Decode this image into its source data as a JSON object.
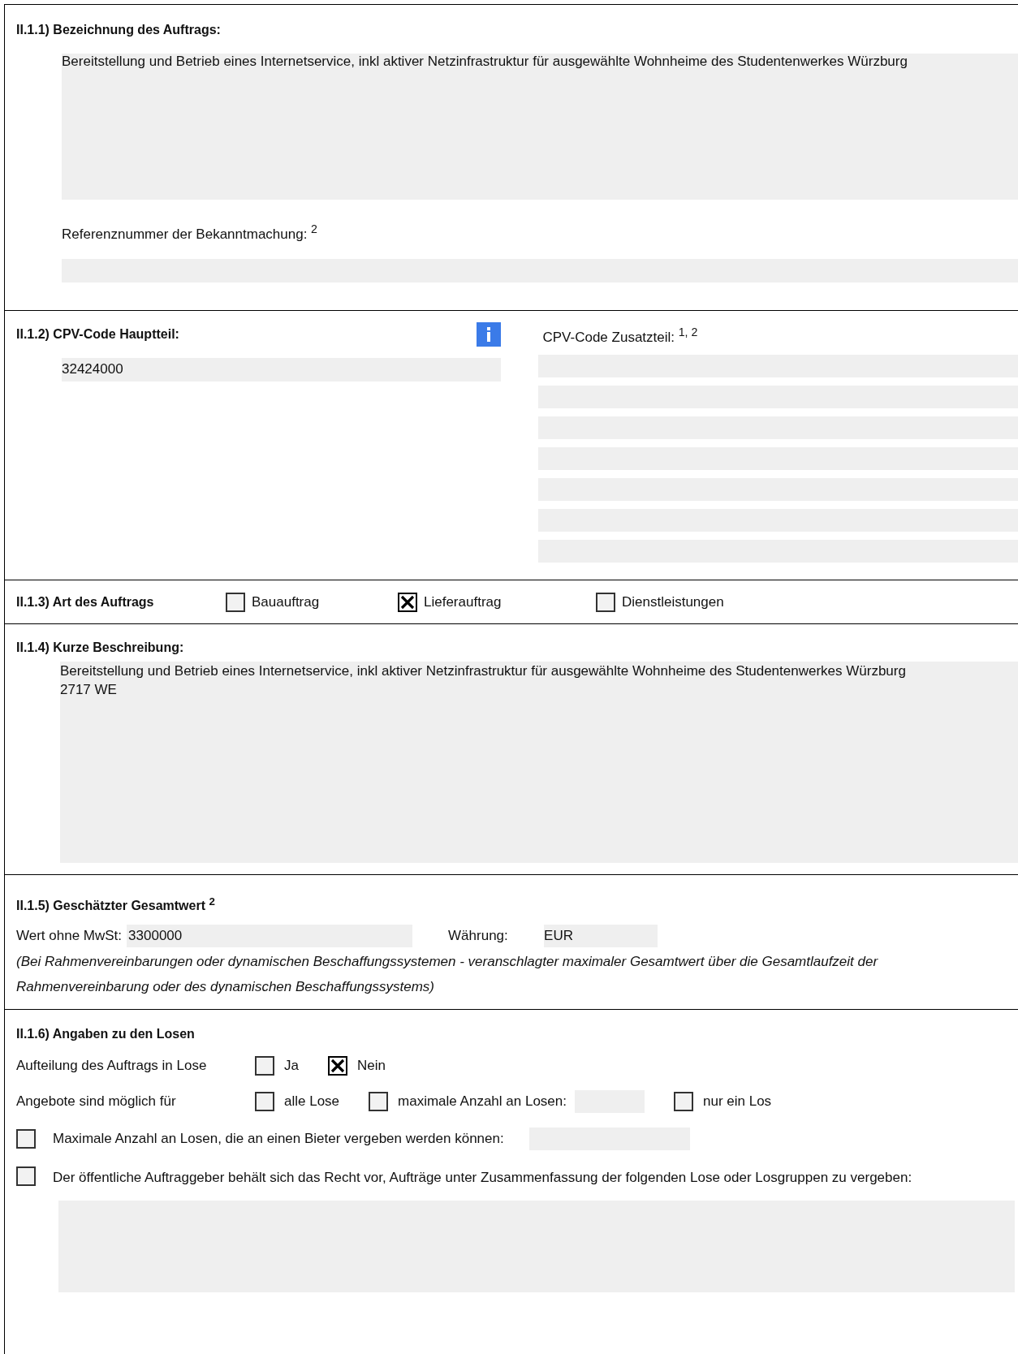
{
  "sections": [
    {
      "kind": "name",
      "title": "II.1.1) Bezeichnung des Auftrags:",
      "value": "Bereitstellung und Betrieb eines Internetservice, inkl aktiver Netzinfrastruktur für ausgewählte Wohnheime des Studentenwerkes Würzburg",
      "reference_label": "Referenznummer der Bekanntmachung:  $^{2}$"
    },
    {
      "kind": "cpv",
      "title": "II.1.2) CPV-Code Hauptteil:",
      "value": "32424000",
      "extra_label": "CPV-Code Zusatzteil:  $^{1,  2}$"
    },
    {
      "kind": "type",
      "title": "II.1.3) Art des Auftrags",
      "options": [
        {
          "label": "Bauauftrag",
          "checked": false
        },
        {
          "label": "Lieferauftrag",
          "checked": true
        },
        {
          "label": "Dienstleistungen",
          "checked": false
        }
      ]
    },
    {
      "kind": "description",
      "title": "II.1.4) Kurze Beschreibung:",
      "value": "Bereitstellung und Betrieb eines Internetservice, inkl aktiver Netzinfrastruktur für ausgewählte Wohnheime des Studentenwerkes Würzburg\n2717 WE"
    },
    {
      "kind": "estimate",
      "title": "II.1.5) Geschätzter Gesamtwert  $^{2}$",
      "value_label": "Wert ohne MwSt:",
      "value": "3300000",
      "currency_label": "Währung:",
      "currency": "EUR",
      "note": "(Bei Rahmenvereinbarungen oder dynamischen Beschaffungssystemen - veranschlagter maximaler  Gesamtwert über die Gesamtlaufzeit der Rahmenvereinbarung oder des  dynamischen Beschaffungssystems)"
    },
    {
      "kind": "lots",
      "title": "II.1.6) Angaben zu den Losen",
      "rows": [
        {
          "kind": "choice",
          "label": "Aufteilung des Auftrags in Lose",
          "options": [
            {
              "kind": "plain",
              "label": "Ja",
              "checked": false
            },
            {
              "kind": "plain",
              "label": "Nein",
              "checked": true
            }
          ]
        },
        {
          "kind": "choice",
          "label": "Angebote sind möglich für",
          "options": [
            {
              "kind": "plain",
              "label": "alle Lose",
              "checked": false
            },
            {
              "kind": "with_field",
              "label": "maximale Anzahl an Losen:",
              "checked": false
            },
            {
              "kind": "plain",
              "label": "nur ein Los",
              "checked": false
            }
          ]
        },
        {
          "kind": "check_field",
          "label": "Maximale Anzahl an Losen, die an einen Bieter vergeben werden können:",
          "checked": false
        },
        {
          "kind": "check_area",
          "label": "Der öffentliche Auftraggeber behält sich das Recht vor, Aufträge unter Zusammenfassung  der folgenden Lose oder Losgruppen  zu vergeben:",
          "checked": false
        }
      ]
    }
  ]
}
